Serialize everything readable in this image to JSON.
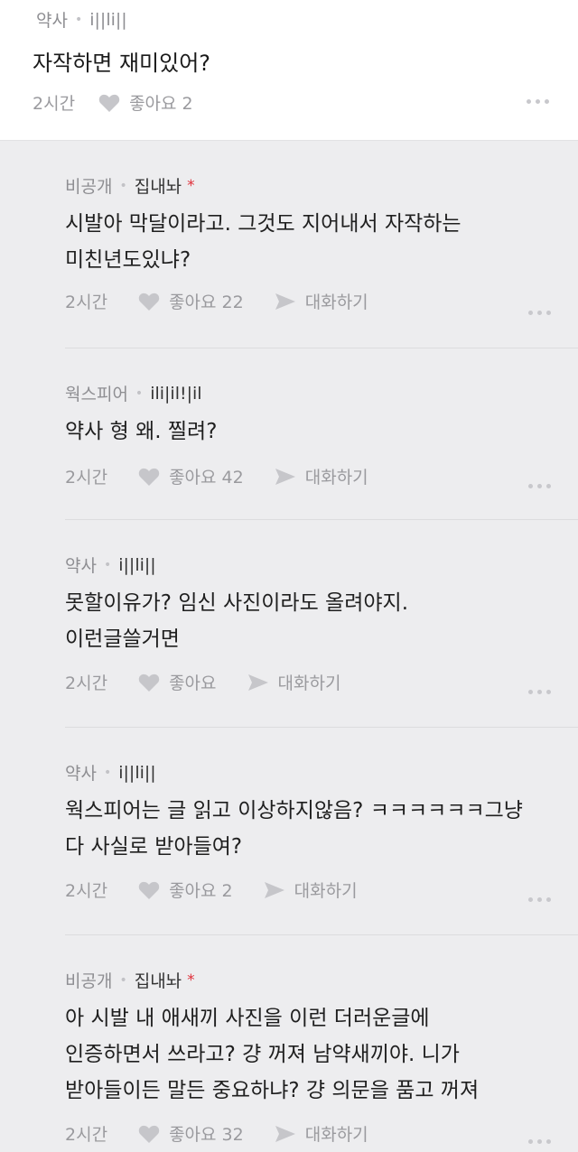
{
  "post": {
    "author": "약사",
    "nickname": "i||li||",
    "body": "자작하면 재미있어?",
    "time": "2시간",
    "like_label": "좋아요 2"
  },
  "comments": [
    {
      "author": "비공개",
      "nickname": "집내놔",
      "star": "*",
      "body": "시발아 막달이라고. 그것도 지어내서 자작하는\n미친년도있냐?",
      "time": "2시간",
      "like_label": "좋아요 22",
      "reply_label": "대화하기"
    },
    {
      "author": "웍스피어",
      "nickname": "ili|il!|il",
      "body": "약사 형 왜. 찔려?",
      "time": "2시간",
      "like_label": "좋아요 42",
      "reply_label": "대화하기"
    },
    {
      "author": "약사",
      "nickname": "i||li||",
      "body": "못할이유가? 임신 사진이라도 올려야지.\n이런글쓸거면",
      "time": "2시간",
      "like_label": "좋아요",
      "reply_label": "대화하기"
    },
    {
      "author": "약사",
      "nickname": "i||li||",
      "body": "웍스피어는 글 읽고 이상하지않음? ㅋㅋㅋㅋㅋㅋ그냥\n다 사실로 받아들여?",
      "time": "2시간",
      "like_label": "좋아요 2",
      "reply_label": "대화하기"
    },
    {
      "author": "비공개",
      "nickname": "집내놔",
      "star": "*",
      "body": "아 시발 내 애새끼 사진을 이런 더러운글에\n인증하면서 쓰라고? 걍 꺼져 남약새끼야. 니가\n받아들이든 말든 중요하냐? 걍 의문을 품고 꺼져",
      "time": "2시간",
      "like_label": "좋아요 32",
      "reply_label": "대화하기"
    }
  ],
  "colors": {
    "background": "#ededef",
    "post_background": "#ffffff",
    "meta_gray": "#9a9a9e",
    "star_red": "#e0303a"
  }
}
